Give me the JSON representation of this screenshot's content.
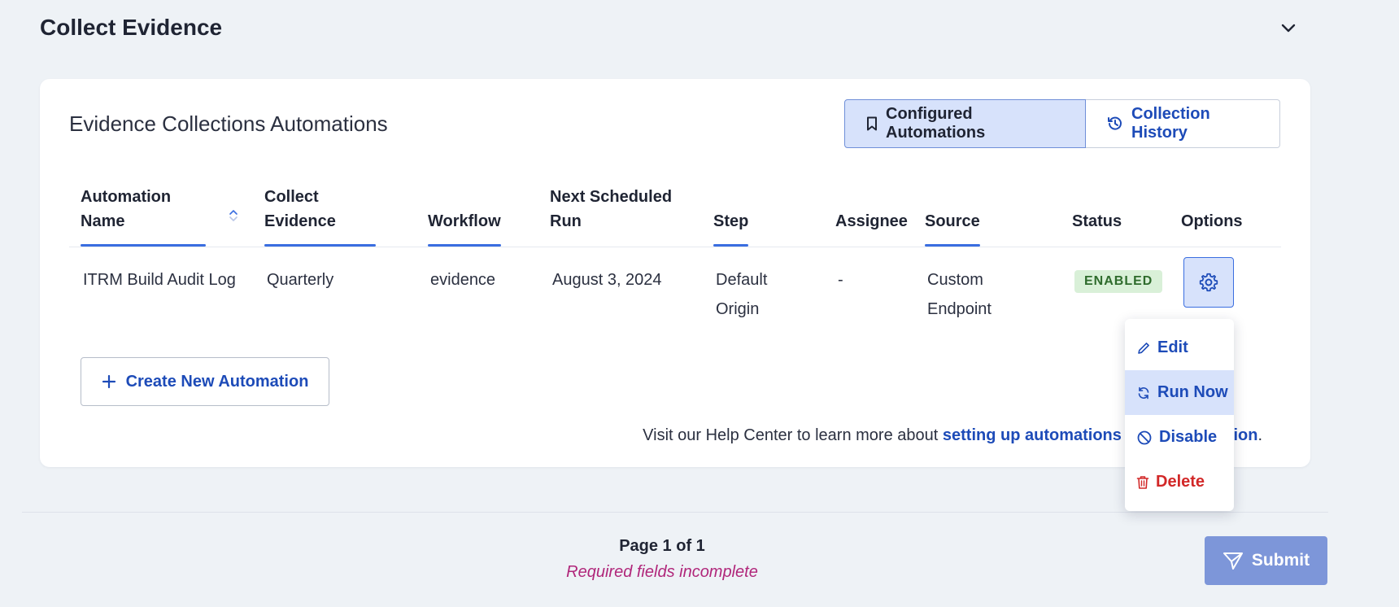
{
  "section": {
    "title": "Collect Evidence"
  },
  "card": {
    "title": "Evidence Collections Automations",
    "tabs": [
      {
        "label": "Configured Automations",
        "icon": "bookmark-icon",
        "active": true
      },
      {
        "label": "Collection History",
        "icon": "history-icon",
        "active": false
      }
    ]
  },
  "table": {
    "headers": {
      "automation_name_1": "Automation",
      "automation_name_2": "Name",
      "collect_1": "Collect",
      "collect_2": "Evidence",
      "workflow": "Workflow",
      "next_run_1": "Next Scheduled",
      "next_run_2": "Run",
      "step": "Step",
      "assignee": "Assignee",
      "source": "Source",
      "status": "Status",
      "options": "Options"
    },
    "rows": [
      {
        "name": "ITRM Build Audit Log",
        "collect": "Quarterly",
        "workflow": "evidence",
        "next_run": "August 3, 2024",
        "step_1": "Default",
        "step_2": "Origin",
        "assignee": "-",
        "source_1": "Custom",
        "source_2": "Endpoint",
        "status": "ENABLED"
      }
    ]
  },
  "create_button": {
    "label": "Create New Automation"
  },
  "help": {
    "prefix": "Visit our Help Center to learn more about ",
    "link_visible_start": "setting up automations for e",
    "link_visible_end": "tion",
    "suffix": "."
  },
  "menu": {
    "items": [
      {
        "label": "Edit",
        "icon": "pencil-icon"
      },
      {
        "label": "Run Now",
        "icon": "refresh-icon"
      },
      {
        "label": "Disable",
        "icon": "ban-icon"
      },
      {
        "label": "Delete",
        "icon": "trash-icon"
      }
    ]
  },
  "footer": {
    "page": "Page 1 of 1",
    "required": "Required fields incomplete",
    "submit": "Submit"
  },
  "colors": {
    "accent": "#1d4bb8",
    "danger": "#d22828",
    "enabled": "#2e6b2c",
    "warning_text": "#b0267a"
  }
}
